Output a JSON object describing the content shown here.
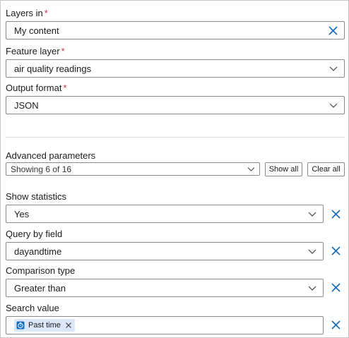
{
  "layers_in": {
    "label": "Layers in",
    "required": "*",
    "value": "My content"
  },
  "feature_layer": {
    "label": "Feature layer",
    "required": "*",
    "value": "air quality readings"
  },
  "output_format": {
    "label": "Output format",
    "required": "*",
    "value": "JSON"
  },
  "advanced": {
    "label": "Advanced parameters",
    "value": "Showing 6 of 16",
    "show_all": "Show all",
    "clear_all": "Clear all"
  },
  "show_statistics": {
    "label": "Show statistics",
    "value": "Yes"
  },
  "query_by_field": {
    "label": "Query by field",
    "value": "dayandtime"
  },
  "comparison_type": {
    "label": "Comparison type",
    "value": "Greater than"
  },
  "search_value": {
    "label": "Search value",
    "chip": "Past time"
  },
  "colors": {
    "accent": "#0f6cbd",
    "required": "#c4314b",
    "chip_bg": "#dbe7f6"
  },
  "icons": [
    "close-icon",
    "chevron-down-icon",
    "clock-icon"
  ]
}
